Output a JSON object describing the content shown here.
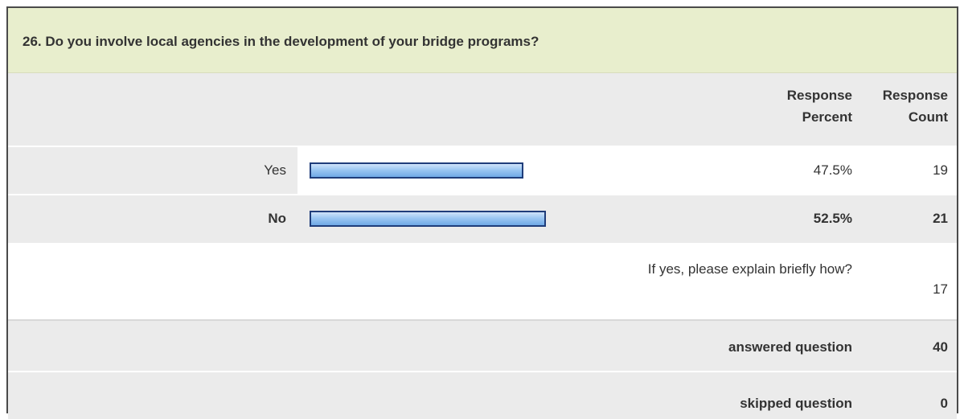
{
  "question": {
    "text": "26. Do you involve local agencies in the development of your bridge programs?"
  },
  "columns": {
    "percent_line1": "Response",
    "percent_line2": "Percent",
    "count_line1": "Response",
    "count_line2": "Count"
  },
  "answers": [
    {
      "label": "Yes",
      "percent_text": "47.5%",
      "percent_value": 47.5,
      "count": "19"
    },
    {
      "label": "No",
      "percent_text": "52.5%",
      "percent_value": 52.5,
      "count": "21"
    }
  ],
  "other": {
    "label": "If yes, please explain briefly how?",
    "count": "17"
  },
  "summary": {
    "answered_label": "answered question",
    "answered_value": "40",
    "skipped_label": "skipped question",
    "skipped_value": "0"
  },
  "colors": {
    "question_bg": "#e8eecd",
    "row_bg": "#ebebeb",
    "bar_border": "#1f3d7a",
    "bar_fill": "#9cc7f2"
  }
}
